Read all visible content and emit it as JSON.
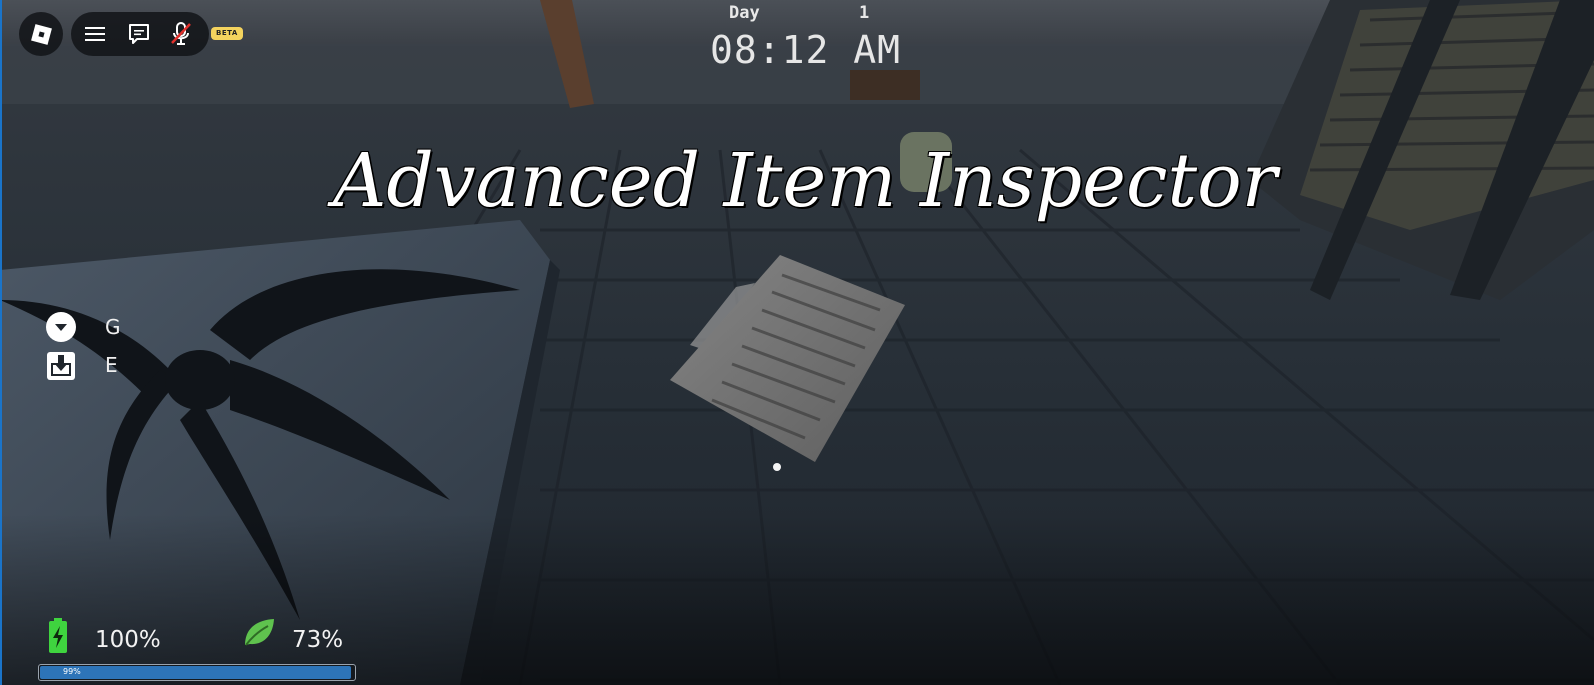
{
  "hud": {
    "beta_label": "BETA",
    "buttons": [
      {
        "name": "roblox-menu-icon"
      },
      {
        "name": "hamburger-menu-icon"
      },
      {
        "name": "chat-icon"
      },
      {
        "name": "microphone-muted-icon"
      }
    ]
  },
  "clock": {
    "day_label": "Day",
    "day_number": "1",
    "time": "08:12 AM"
  },
  "inspector": {
    "title": "Advanced Item Inspector"
  },
  "keybinds": [
    {
      "icon": "drop-down-circle-icon",
      "key": "G"
    },
    {
      "icon": "inventory-download-icon",
      "key": "E"
    }
  ],
  "stats": {
    "battery": {
      "icon": "battery-charging-icon",
      "value": "100%",
      "color": "#3fd43f"
    },
    "stamina": {
      "icon": "leaf-icon",
      "value": "73%",
      "color": "#5fc24e"
    },
    "progress": {
      "label": "99%",
      "fraction": 0.99,
      "color": "#2d74b8"
    }
  }
}
